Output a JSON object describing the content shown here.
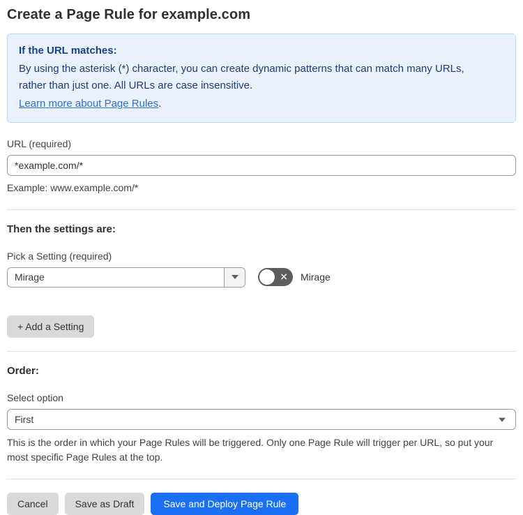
{
  "page": {
    "title": "Create a Page Rule for example.com"
  },
  "callout": {
    "heading": "If the URL matches:",
    "body": "By using the asterisk (*) character, you can create dynamic patterns that can match many URLs, rather than just one. All URLs are case insensitive.",
    "link_label": "Learn more about Page Rules",
    "link_suffix": "."
  },
  "url_section": {
    "label": "URL (required)",
    "value": "*example.com/*",
    "helper": "Example: www.example.com/*"
  },
  "settings_section": {
    "heading": "Then the settings are:",
    "picker_label": "Pick a Setting (required)",
    "selected_setting": "Mirage",
    "toggle": {
      "state": "off",
      "label": "Mirage"
    },
    "add_setting_label": "+ Add a Setting"
  },
  "order_section": {
    "heading": "Order:",
    "label": "Select option",
    "selected_option": "First",
    "helper": "This is the order in which your Page Rules will be triggered. Only one Page Rule will trigger per URL, so put your most specific Page Rules at the top."
  },
  "footer": {
    "cancel_label": "Cancel",
    "save_draft_label": "Save as Draft",
    "save_deploy_label": "Save and Deploy Page Rule"
  },
  "colors": {
    "accent_blue": "#1a70f4",
    "callout_background": "#e9f2fc",
    "callout_border": "#bfd8f2",
    "callout_text": "#1e3c78",
    "link_blue": "#2d6fd3",
    "gray_button": "#d9d9d9",
    "toggle_off": "#5d5d5d"
  }
}
